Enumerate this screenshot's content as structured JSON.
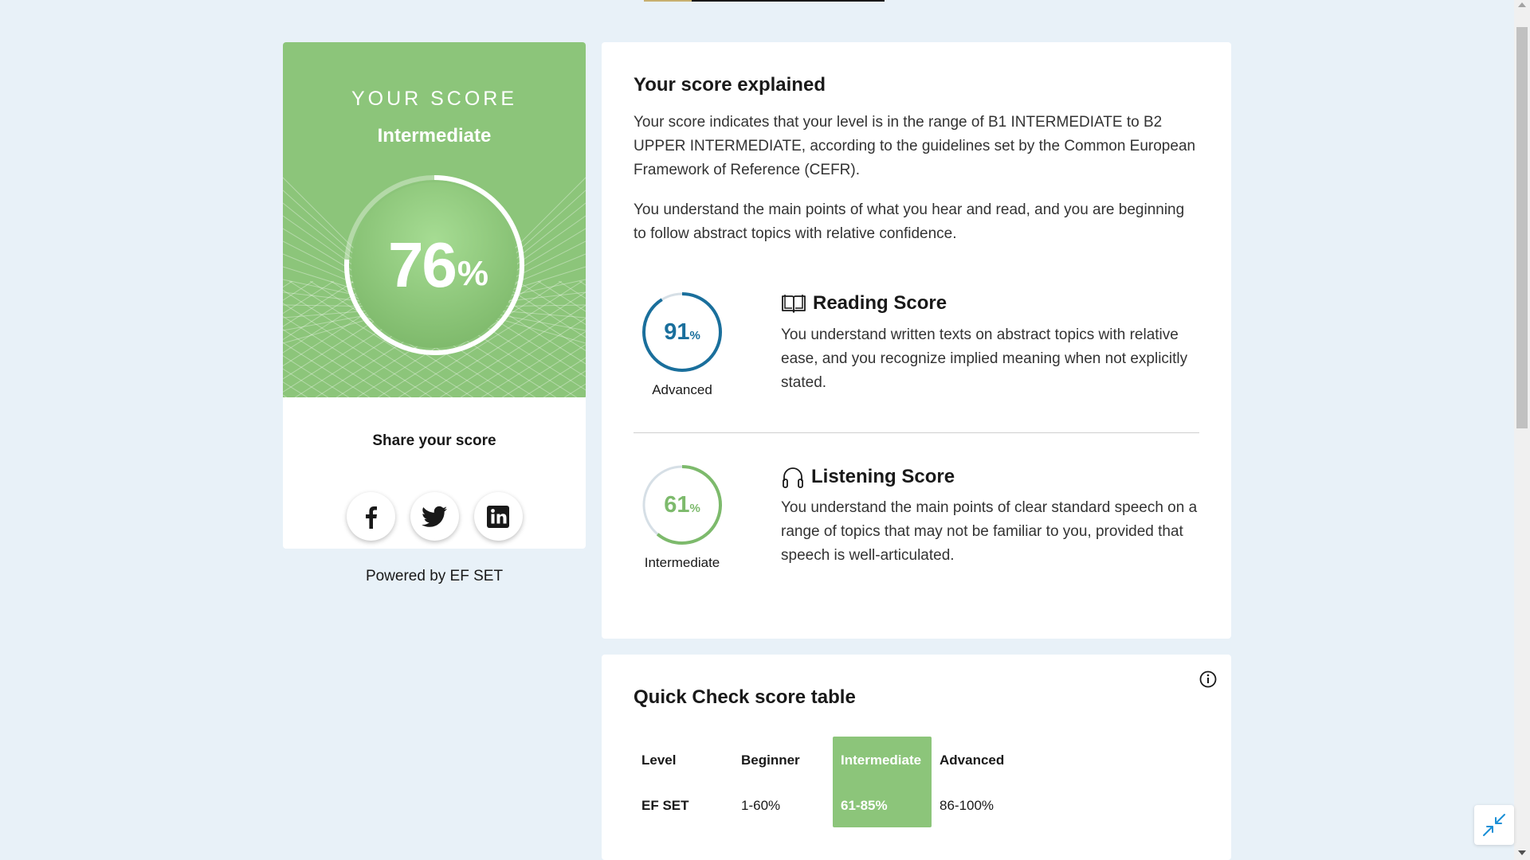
{
  "progress": {
    "value": 0.2
  },
  "score_card": {
    "eyebrow": "YOUR SCORE",
    "level": "Intermediate",
    "score": {
      "value": 76,
      "number": "76",
      "unit": "%"
    },
    "share_title": "Share your score",
    "social": [
      {
        "name": "facebook",
        "icon": "facebook-icon"
      },
      {
        "name": "twitter",
        "icon": "twitter-icon"
      },
      {
        "name": "linkedin",
        "icon": "linkedin-icon"
      }
    ],
    "powered_by": "Powered by EF SET"
  },
  "explain": {
    "title": "Your score explained",
    "paragraph1": "Your score indicates that your level is in the range of B1 INTERMEDIATE to B2 UPPER INTERMEDIATE, according to the guidelines set by the Common European Framework of Reference (CEFR).",
    "paragraph2": "You understand the main points of what you hear and read, and you are beginning to follow abstract topics with relative confidence.",
    "reading": {
      "title": "Reading Score",
      "score": {
        "value": 91,
        "number": "91",
        "unit": "%"
      },
      "level": "Advanced",
      "description": "You understand written texts on abstract topics with relative ease, and you recognize implied meaning when not explicitly stated.",
      "icon": "book-icon",
      "color": "#1a6f9c"
    },
    "listening": {
      "title": "Listening Score",
      "score": {
        "value": 61,
        "number": "61",
        "unit": "%"
      },
      "level": "Intermediate",
      "description": "You understand the main points of clear standard speech on a range of topics that may not be familiar to you, provided that speech is well-articulated.",
      "icon": "headphones-icon",
      "color": "#7dba6c"
    }
  },
  "score_table": {
    "title": "Quick Check score table",
    "row_headers": [
      "Level",
      "EF SET"
    ],
    "columns": [
      {
        "level": "Beginner",
        "range": "1-60%",
        "highlighted": false
      },
      {
        "level": "Intermediate",
        "range": "61-85%",
        "highlighted": true
      },
      {
        "level": "Advanced",
        "range": "86-100%",
        "highlighted": false
      }
    ]
  },
  "colors": {
    "background": "#e8f1f8",
    "card_green": "#8cc57a",
    "reading_blue": "#1a6f9c",
    "listening_green": "#7dba6c"
  }
}
